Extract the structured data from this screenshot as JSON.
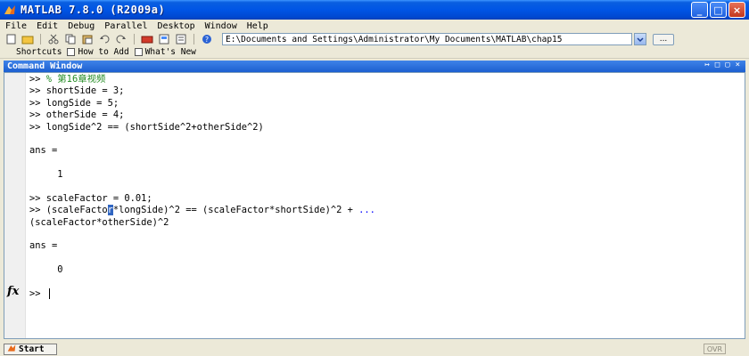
{
  "window": {
    "title": "MATLAB  7.8.0  (R2009a)"
  },
  "menu": [
    "File",
    "Edit",
    "Debug",
    "Parallel",
    "Desktop",
    "Window",
    "Help"
  ],
  "toolbar": {
    "current_folder": "E:\\Documents and Settings\\Administrator\\My Documents\\MATLAB\\chap15",
    "browse_label": "..."
  },
  "shortcuts": {
    "label": "Shortcuts",
    "items": [
      "How to Add",
      "What's New"
    ]
  },
  "command_window": {
    "title": "Command Window",
    "lines": [
      {
        "prompt": ">> ",
        "text": "% 第16章视频",
        "kind": "comment"
      },
      {
        "prompt": ">> ",
        "text": "shortSide = 3;"
      },
      {
        "prompt": ">> ",
        "text": "longSide = 5;"
      },
      {
        "prompt": ">> ",
        "text": "otherSide = 4;"
      },
      {
        "prompt": ">> ",
        "text": "longSide^2 == (shortSide^2+otherSide^2)"
      },
      {
        "prompt": "",
        "text": ""
      },
      {
        "prompt": "",
        "text": "ans ="
      },
      {
        "prompt": "",
        "text": ""
      },
      {
        "prompt": "",
        "text": "     1"
      },
      {
        "prompt": "",
        "text": ""
      },
      {
        "prompt": ">> ",
        "text": "scaleFactor = 0.01;"
      },
      {
        "prompt": ">> ",
        "text_pre": "(scaleFacto",
        "text_sel": "r",
        "text_post": "*longSide)^2 == (scaleFactor*shortSide)^2 + ",
        "text_cont": "...",
        "kind": "selected"
      },
      {
        "prompt": "",
        "text": "(scaleFactor*otherSide)^2",
        "kind": "continuation"
      },
      {
        "prompt": "",
        "text": ""
      },
      {
        "prompt": "",
        "text": "ans ="
      },
      {
        "prompt": "",
        "text": ""
      },
      {
        "prompt": "",
        "text": "     0"
      },
      {
        "prompt": "",
        "text": ""
      },
      {
        "prompt": ">> ",
        "text": "",
        "kind": "active"
      }
    ],
    "fx_label": "fx"
  },
  "status": {
    "start_label": "Start",
    "ovr_label": "OVR"
  }
}
